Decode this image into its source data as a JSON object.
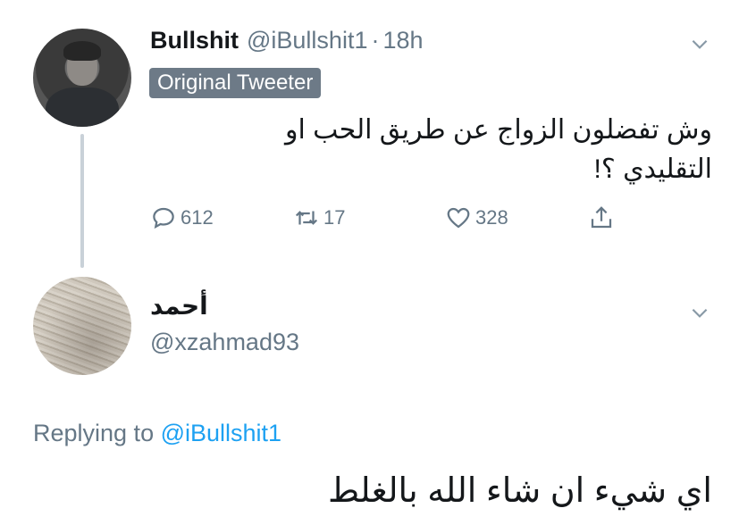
{
  "tweet": {
    "display_name": "Bullshit",
    "handle": "@iBullshit1",
    "dot": "·",
    "time": "18h",
    "badge": "Original Tweeter",
    "text": "وش تفضلون الزواج عن طريق الحب او التقليدي ؟!",
    "replies": "612",
    "retweets": "17",
    "likes": "328"
  },
  "reply": {
    "display_name": "أحمد",
    "handle": "@xzahmad93",
    "replying_label": "Replying to",
    "replying_to": "@iBullshit1",
    "text": "اي شيء ان شاء الله بالغلط"
  },
  "icons": {
    "reply": "speech-bubble-icon",
    "retweet": "retweet-icon",
    "like": "heart-icon",
    "share": "share-icon",
    "more": "chevron-down-icon"
  },
  "colors": {
    "secondary_text": "#657786",
    "link": "#1da1f2",
    "badge_bg": "#6d7a87",
    "thread_line": "#c9d1d8"
  }
}
